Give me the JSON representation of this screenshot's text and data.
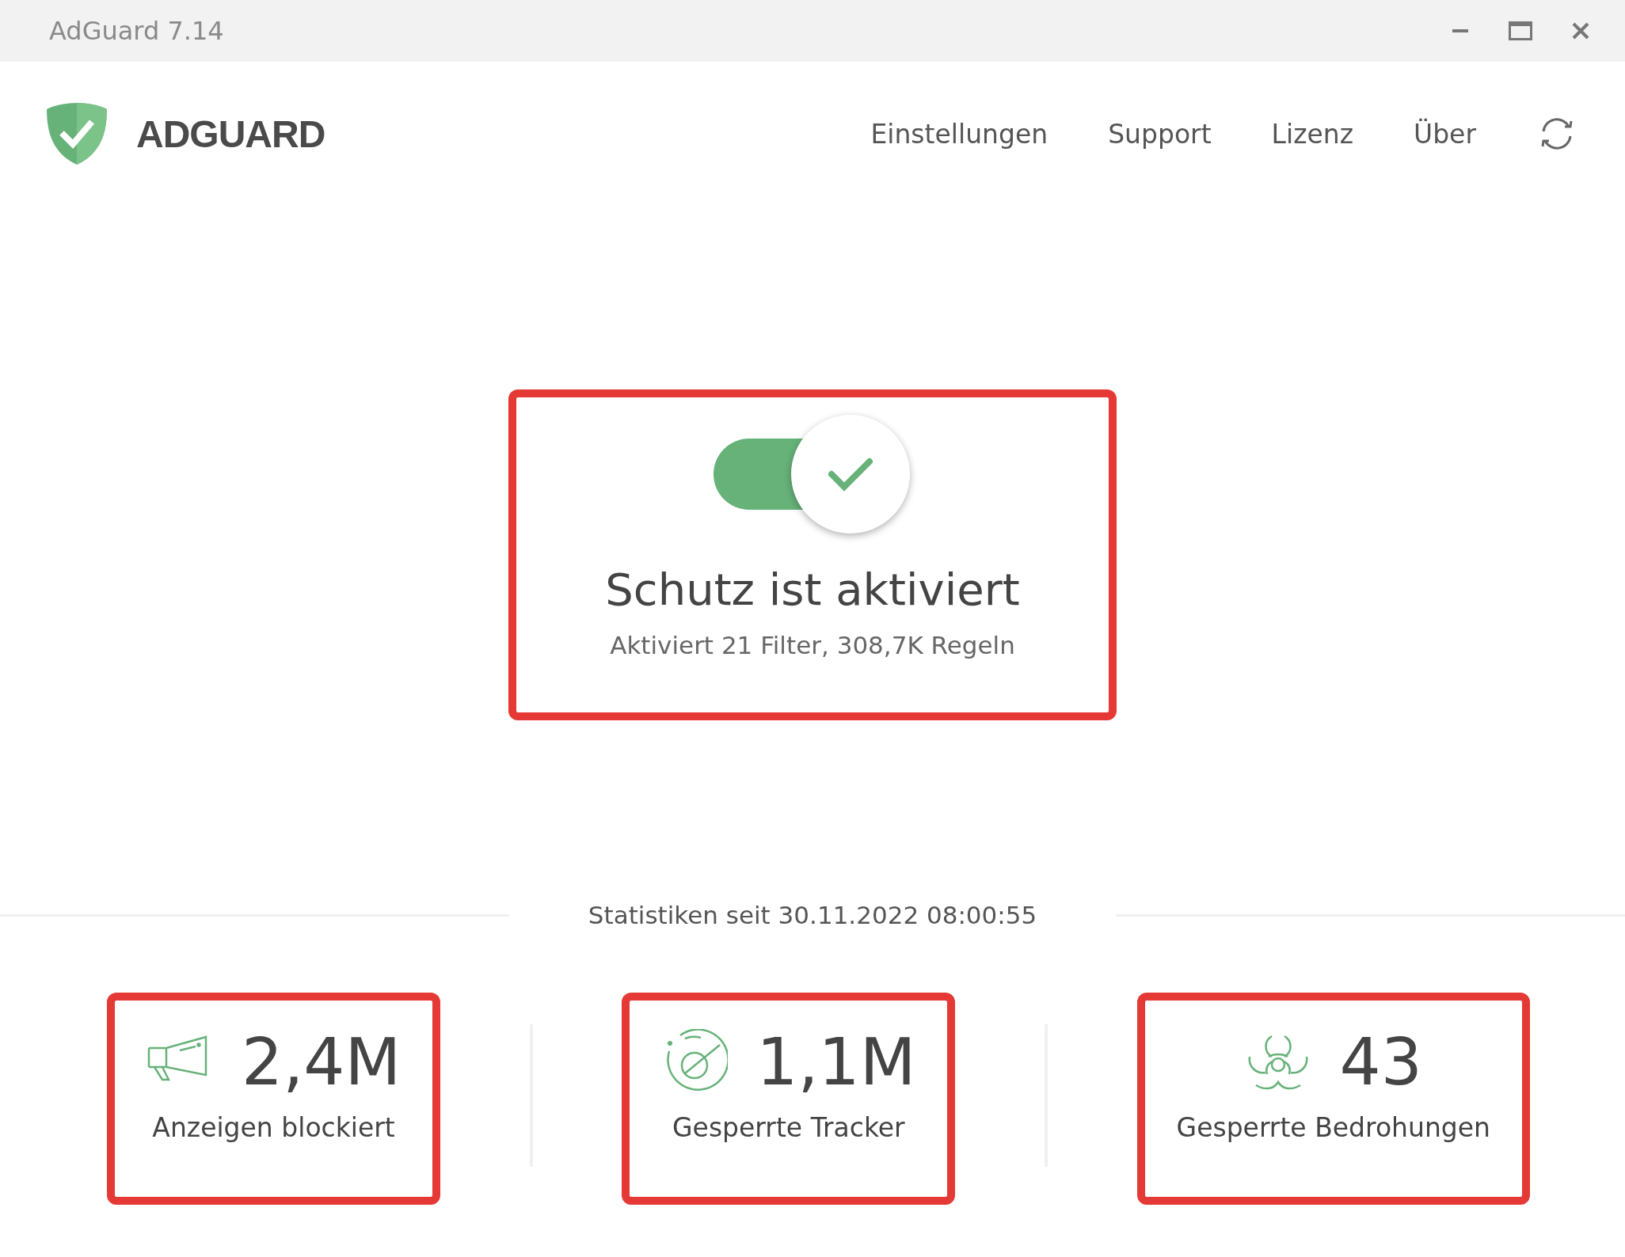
{
  "window": {
    "title": "AdGuard 7.14"
  },
  "header": {
    "logo_text": "ADGUARD",
    "nav": [
      "Einstellungen",
      "Support",
      "Lizenz",
      "Über"
    ]
  },
  "protection": {
    "enabled": true,
    "title": "Schutz ist aktiviert",
    "subtitle": "Aktiviert 21 Filter, 308,7K Regeln"
  },
  "statistics": {
    "since": "Statistiken seit 30.11.2022 08:00:55",
    "items": [
      {
        "kind": "ads",
        "value": "2,4M",
        "label": "Anzeigen blockiert"
      },
      {
        "kind": "trackers",
        "value": "1,1M",
        "label": "Gesperrte Tracker"
      },
      {
        "kind": "threats",
        "value": "43",
        "label": "Gesperrte Bedrohungen"
      }
    ]
  }
}
